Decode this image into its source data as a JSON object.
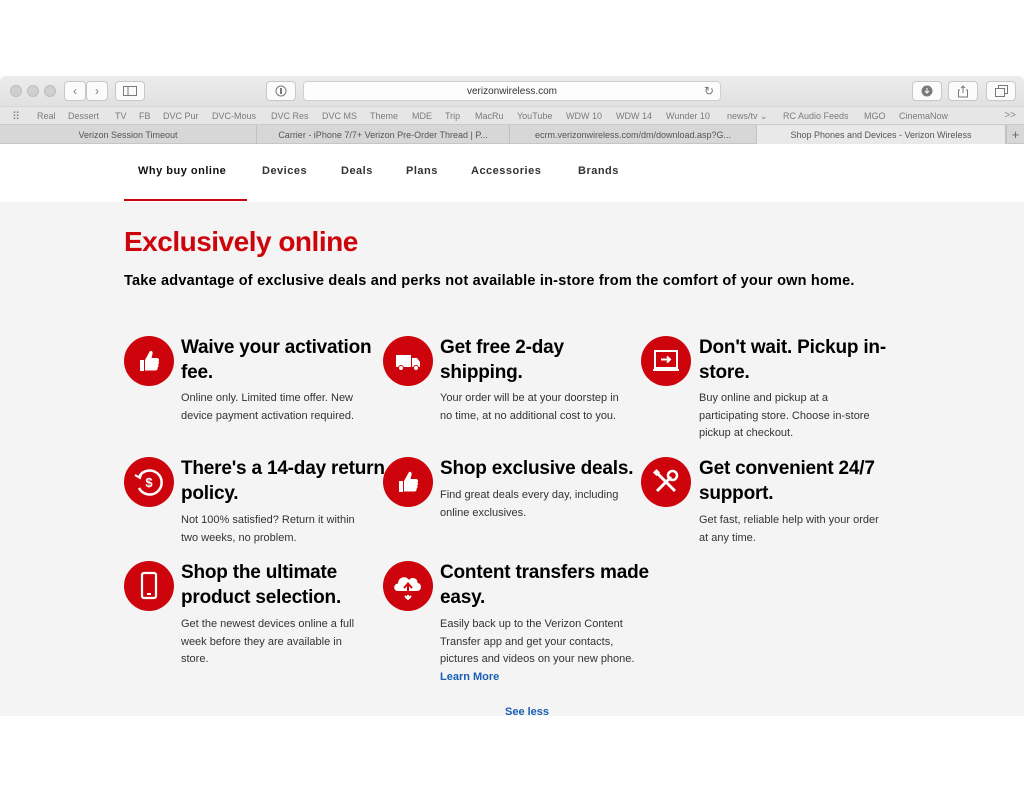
{
  "browser": {
    "url": "verizonwireless.com",
    "bookmarks": [
      "Real",
      "Dessert",
      "TV",
      "FB",
      "DVC Pur",
      "DVC-Mous",
      "DVC Res",
      "DVC MS",
      "Theme",
      "MDE",
      "Trip",
      "MacRu",
      "YouTube",
      "WDW 10",
      "WDW 14",
      "Wunder 10",
      "news/tv ⌄",
      "RC Audio Feeds",
      "MGO",
      "CinemaNow"
    ],
    "bookmarks_more": ">>",
    "tabs": [
      {
        "label": "Verizon Session Timeout",
        "active": false
      },
      {
        "label": "Carrier - iPhone 7/7+ Verizon Pre-Order Thread | P...",
        "active": false
      },
      {
        "label": "ecrm.verizonwireless.com/dm/download.asp?G...",
        "active": false
      },
      {
        "label": "Shop Phones and Devices - Verizon Wireless",
        "active": true
      }
    ],
    "new_tab": "+"
  },
  "nav": {
    "items": [
      "Why buy online",
      "Devices",
      "Deals",
      "Plans",
      "Accessories",
      "Brands"
    ]
  },
  "headline": "Exclusively online",
  "subhead": "Take advantage of exclusive deals and perks not available in-store from the comfort of your own home.",
  "features": [
    {
      "icon": "thumbs-up-icon",
      "title": "Waive your activation fee.",
      "desc": "Online only. Limited time offer. New device payment activation required."
    },
    {
      "icon": "truck-icon",
      "title": "Get free 2-day shipping.",
      "desc": "Your order will be at your doorstep in no time, at no additional cost to you."
    },
    {
      "icon": "store-pickup-icon",
      "title": "Don't wait. Pickup in-store.",
      "desc": "Buy online and pickup at a participating store. Choose in-store pickup at checkout."
    },
    {
      "icon": "return-dollar-icon",
      "title": "There's a 14-day return policy.",
      "desc": "Not 100% satisfied? Return it within two weeks, no problem."
    },
    {
      "icon": "thumbs-up-icon",
      "title": "Shop exclusive deals.",
      "desc": "Find great deals every day, including online exclusives."
    },
    {
      "icon": "tools-icon",
      "title": "Get convenient 24/7 support.",
      "desc": "Get fast, reliable help with your order at any time."
    },
    {
      "icon": "phone-icon",
      "title": "Shop the ultimate product selection.",
      "desc": "Get the newest devices online a full week before they are available in store."
    },
    {
      "icon": "cloud-transfer-icon",
      "title": "Content transfers made easy.",
      "desc": "Easily back up to the Verizon Content Transfer app and get your contacts, pictures and videos on your new phone.",
      "link": "Learn More"
    }
  ],
  "see_less": "See less",
  "colors": {
    "brand_red": "#cd040b",
    "link_blue": "#1a5fb4"
  }
}
